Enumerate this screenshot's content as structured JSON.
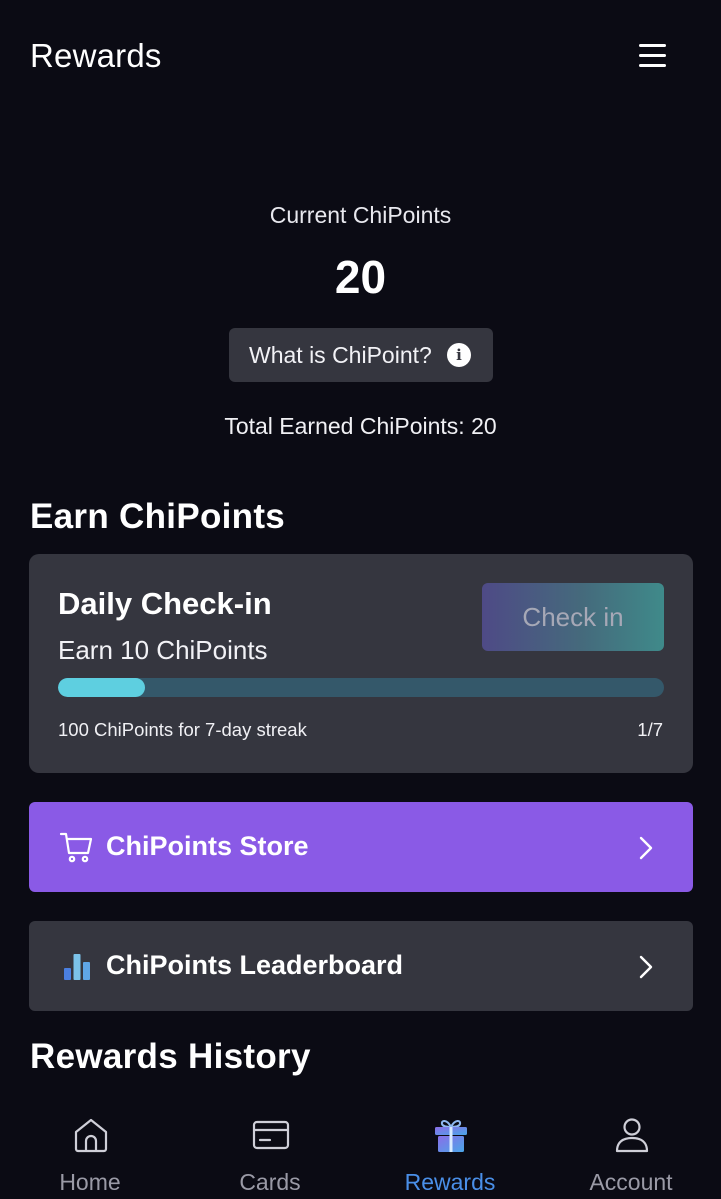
{
  "header": {
    "title": "Rewards",
    "menu_icon": "hamburger-menu-icon"
  },
  "points": {
    "label": "Current ChiPoints",
    "value": "20",
    "what_is_label": "What is ChiPoint?",
    "info_icon": "info-icon",
    "info_glyph": "i",
    "total_earned": "Total Earned ChiPoints: 20"
  },
  "earn": {
    "section_title": "Earn ChiPoints",
    "daily_checkin": {
      "title": "Daily Check-in",
      "subtitle": "Earn 10 ChiPoints",
      "button_label": "Check in",
      "button_state": "disabled",
      "streak_text": "100 ChiPoints for 7-day streak",
      "streak_count": "1/7",
      "progress_fraction": 0.142857
    }
  },
  "actions": {
    "store": {
      "label": "ChiPoints Store",
      "icon": "shopping-cart-icon",
      "color": "#8a5ae6"
    },
    "leaderboard": {
      "label": "ChiPoints Leaderboard",
      "icon": "bar-chart-icon",
      "color": "#35363f"
    }
  },
  "history": {
    "section_title": "Rewards History"
  },
  "nav": {
    "items": [
      {
        "label": "Home",
        "icon": "home-icon",
        "active": false
      },
      {
        "label": "Cards",
        "icon": "card-icon",
        "active": false
      },
      {
        "label": "Rewards",
        "icon": "gift-icon",
        "active": true
      },
      {
        "label": "Account",
        "icon": "user-icon",
        "active": false
      }
    ]
  },
  "colors": {
    "background": "#0b0b14",
    "card": "#35363f",
    "accent_purple": "#8a5ae6",
    "progress": "#5ecfe0",
    "nav_active": "#4a8fe8",
    "nav_inactive": "#9a9aa6"
  }
}
